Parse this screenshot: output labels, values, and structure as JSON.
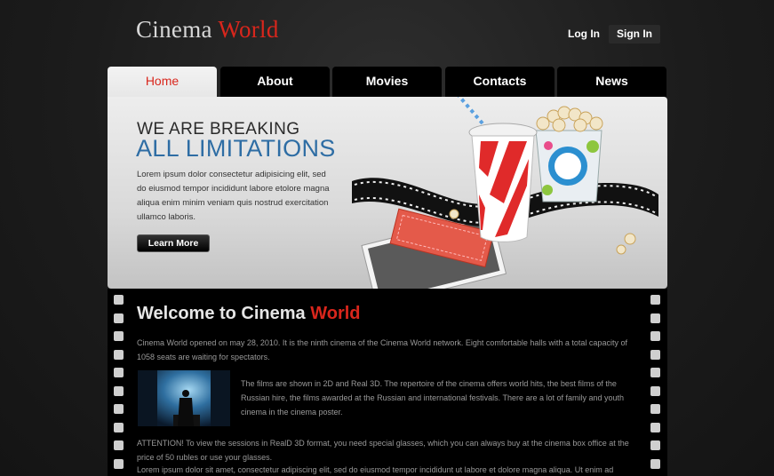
{
  "header": {
    "logo_main": "Cinema",
    "logo_accent": "World",
    "login_label": "Log In",
    "signin_label": "Sign In"
  },
  "nav": {
    "tabs": [
      {
        "label": "Home",
        "active": true
      },
      {
        "label": "About",
        "active": false
      },
      {
        "label": "Movies",
        "active": false
      },
      {
        "label": "Contacts",
        "active": false
      },
      {
        "label": "News",
        "active": false
      }
    ]
  },
  "hero": {
    "title_line1": "WE ARE BREAKING",
    "title_line2": "ALL LIMITATIONS",
    "text": "Lorem ipsum dolor consectetur adipisicing elit, sed do eiusmod tempor incididunt labore etolore magna aliqua enim minim veniam quis nostrud exercitation ullamco laboris.",
    "button_label": "Learn More"
  },
  "main": {
    "heading_main": "Welcome to Cinema ",
    "heading_accent": "World",
    "para1": "Cinema World opened on may 28, 2010. It is the ninth cinema of the Cinema World network. Eight comfortable halls with a total capacity of 1058 seats are waiting for spectators.",
    "para2": "The films are shown in 2D and Real 3D. The repertoire of the cinema offers world hits, the best films of the Russian hire, the films awarded at the Russian and international festivals. There are a lot of family and youth cinema in the cinema poster.",
    "para3": "ATTENTION! To view the sessions in RealD 3D format, you need special glasses, which you can always buy at the cinema box office at the price of 50 rubles or use your glasses.",
    "para4": "Lorem ipsum dolor sit amet, consectetur adipiscing elit, sed do eiusmod tempor incididunt ut labore et dolore magna aliqua. Ut enim ad"
  },
  "colors": {
    "accent_red": "#d9261c",
    "accent_blue": "#2e6da4",
    "background": "#1c1c1c"
  }
}
